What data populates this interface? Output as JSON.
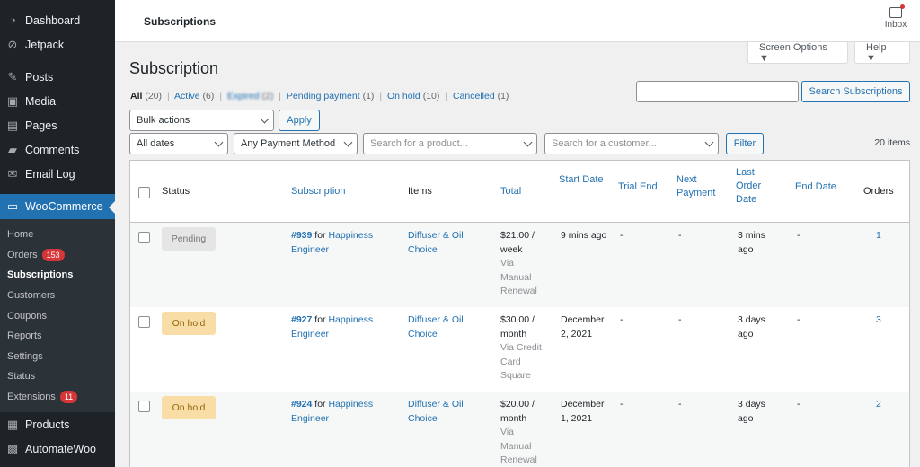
{
  "sidebar": {
    "top_items": [
      {
        "label": "Dashboard",
        "icon": "dashboard-icon"
      },
      {
        "label": "Jetpack",
        "icon": "jetpack-icon"
      },
      {
        "label": "Posts",
        "icon": "pin-icon"
      },
      {
        "label": "Media",
        "icon": "media-icon"
      },
      {
        "label": "Pages",
        "icon": "pages-icon"
      },
      {
        "label": "Comments",
        "icon": "comment-icon"
      },
      {
        "label": "Email Log",
        "icon": "email-icon"
      }
    ],
    "active_item": {
      "label": "WooCommerce",
      "icon": "woo-icon"
    },
    "submenu": [
      {
        "label": "Home"
      },
      {
        "label": "Orders",
        "badge": "153"
      },
      {
        "label": "Subscriptions"
      },
      {
        "label": "Customers"
      },
      {
        "label": "Coupons"
      },
      {
        "label": "Reports"
      },
      {
        "label": "Settings"
      },
      {
        "label": "Status"
      },
      {
        "label": "Extensions",
        "badge": "11"
      }
    ],
    "bottom_items": [
      {
        "label": "Products",
        "icon": "products-icon"
      },
      {
        "label": "AutomateWoo",
        "icon": "automatewoo-icon"
      }
    ]
  },
  "header": {
    "title": "Subscriptions",
    "inbox_label": "Inbox",
    "screen_options": "Screen Options ▼",
    "help": "Help ▼"
  },
  "page": {
    "heading": "Subscription",
    "filters": {
      "all": "All",
      "all_count": "(20)",
      "active": "Active",
      "active_count": "(6)",
      "expired": "Expired",
      "expired_count": "(2)",
      "pending": "Pending payment",
      "pending_count": "(1)",
      "onhold": "On hold",
      "onhold_count": "(10)",
      "cancelled": "Cancelled",
      "cancelled_count": "(1)"
    },
    "search_button": "Search Subscriptions",
    "bulk_actions": "Bulk actions",
    "apply": "Apply",
    "dates": "All dates",
    "payment_method": "Any Payment Method",
    "product_placeholder": "Search for a product...",
    "customer_placeholder": "Search for a customer...",
    "filter": "Filter",
    "items_count": "20 items"
  },
  "table": {
    "columns": {
      "status": "Status",
      "subscription": "Subscription",
      "items": "Items",
      "total": "Total",
      "start_date": "Start Date",
      "trial_end": "Trial End",
      "next_payment": "Next Payment",
      "last_order_date": "Last Order Date",
      "end_date": "End Date",
      "orders": "Orders"
    },
    "rows": [
      {
        "status": "Pending",
        "sub_id": "#939",
        "for": "for",
        "customer": "Happiness Engineer",
        "item": "Diffuser & Oil Choice",
        "total": "$21.00 / week",
        "via": "Via Manual Renewal",
        "start": "9 mins ago",
        "trial_end": "-",
        "next_payment": "-",
        "last_order": "3 mins ago",
        "end_date": "-",
        "orders": "1"
      },
      {
        "status": "On hold",
        "sub_id": "#927",
        "for": "for",
        "customer": "Happiness Engineer",
        "item": "Diffuser & Oil Choice",
        "total": "$30.00 / month",
        "via": "Via Credit Card Square",
        "start": "December 2, 2021",
        "trial_end": "-",
        "next_payment": "-",
        "last_order": "3 days ago",
        "end_date": "-",
        "orders": "3"
      },
      {
        "status": "On hold",
        "sub_id": "#924",
        "for": "for",
        "customer": "Happiness Engineer",
        "item": "Diffuser & Oil Choice",
        "total": "$20.00 / month",
        "via": "Via Manual Renewal",
        "start": "December 1, 2021",
        "trial_end": "-",
        "next_payment": "-",
        "last_order": "3 days ago",
        "end_date": "-",
        "orders": "2"
      }
    ]
  }
}
